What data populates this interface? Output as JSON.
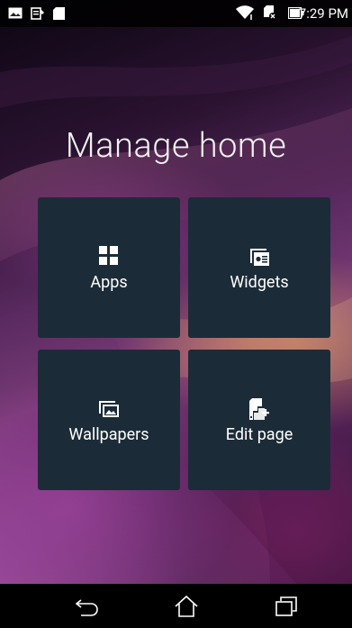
{
  "status_bar": {
    "time": "7:29 PM",
    "left_icons": [
      "image-notification-icon",
      "clipboard-notification-icon",
      "sd-card-icon"
    ],
    "right_icons": [
      "wifi-icon",
      "no-sim-icon",
      "battery-icon"
    ]
  },
  "title": "Manage home",
  "tiles": [
    {
      "label": "Apps",
      "icon": "apps-grid-icon"
    },
    {
      "label": "Widgets",
      "icon": "widgets-icon"
    },
    {
      "label": "Wallpapers",
      "icon": "wallpapers-icon"
    },
    {
      "label": "Edit page",
      "icon": "edit-page-icon"
    }
  ],
  "nav_bar": {
    "buttons": [
      "back-icon",
      "home-icon",
      "recents-icon"
    ]
  },
  "colors": {
    "tile_background": "#1c2b38",
    "status_bar": "#000000",
    "text": "#ffffff"
  }
}
